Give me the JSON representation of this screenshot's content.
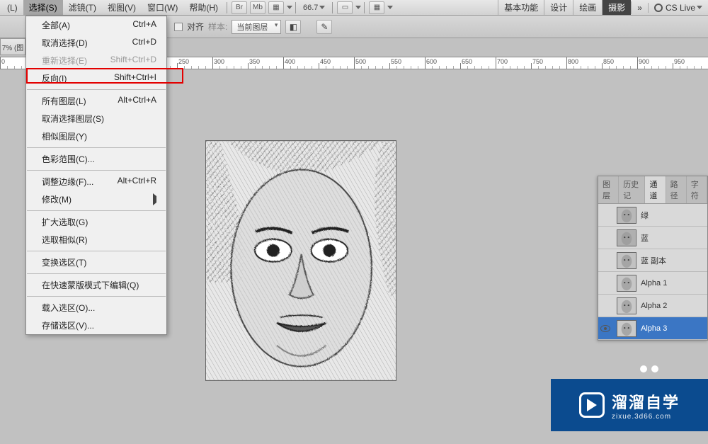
{
  "menubar": {
    "items": [
      {
        "label": "(L)"
      },
      {
        "label": "选择(S)",
        "active": true
      },
      {
        "label": "滤镜(T)"
      },
      {
        "label": "视图(V)"
      },
      {
        "label": "窗口(W)"
      },
      {
        "label": "帮助(H)"
      }
    ],
    "iconbtns": [
      "Br",
      "Mb",
      "▦"
    ],
    "zoom": "66.7",
    "right_tabs": [
      {
        "label": "基本功能"
      },
      {
        "label": "设计"
      },
      {
        "label": "绘画"
      },
      {
        "label": "摄影",
        "active": true
      },
      {
        "label": "»"
      }
    ],
    "cslive": "CS Live"
  },
  "optbar": {
    "align_label": "对齐",
    "sample_label": "样本:",
    "sample_value": "当前图层"
  },
  "leftedge": "7% (图",
  "dropdown": {
    "groups": [
      [
        {
          "label": "全部(A)",
          "shortcut": "Ctrl+A"
        },
        {
          "label": "取消选择(D)",
          "shortcut": "Ctrl+D"
        },
        {
          "label": "重新选择(E)",
          "shortcut": "Shift+Ctrl+D",
          "disabled": true
        },
        {
          "label": "反向(I)",
          "shortcut": "Shift+Ctrl+I",
          "highlight": true
        }
      ],
      [
        {
          "label": "所有图层(L)",
          "shortcut": "Alt+Ctrl+A"
        },
        {
          "label": "取消选择图层(S)"
        },
        {
          "label": "相似图层(Y)"
        }
      ],
      [
        {
          "label": "色彩范围(C)..."
        }
      ],
      [
        {
          "label": "调整边缘(F)...",
          "shortcut": "Alt+Ctrl+R"
        },
        {
          "label": "修改(M)",
          "arrow": true
        }
      ],
      [
        {
          "label": "扩大选取(G)"
        },
        {
          "label": "选取相似(R)"
        }
      ],
      [
        {
          "label": "变换选区(T)"
        }
      ],
      [
        {
          "label": "在快速蒙版模式下编辑(Q)"
        }
      ],
      [
        {
          "label": "载入选区(O)..."
        },
        {
          "label": "存储选区(V)..."
        }
      ]
    ]
  },
  "ruler": {
    "start": 0,
    "end": 1000,
    "step": 50
  },
  "panel": {
    "tabs": [
      {
        "label": "图层"
      },
      {
        "label": "历史记"
      },
      {
        "label": "通道",
        "active": true
      },
      {
        "label": "路径"
      },
      {
        "label": "字符"
      }
    ],
    "channels": [
      {
        "name": "绿",
        "eye": false,
        "color": "#b8b8b8"
      },
      {
        "name": "蓝",
        "eye": false,
        "color": "#b0b0b0"
      },
      {
        "name": "蓝 副本",
        "eye": false,
        "color": "#c2c2c2"
      },
      {
        "name": "Alpha 1",
        "eye": false,
        "color": "#c6c6c6"
      },
      {
        "name": "Alpha 2",
        "eye": false,
        "color": "#c8c8c8"
      },
      {
        "name": "Alpha 3",
        "eye": true,
        "selected": true,
        "color": "#cacaca"
      }
    ]
  },
  "watermark": {
    "big": "溜溜自学",
    "small": "zixue.3d66.com"
  }
}
